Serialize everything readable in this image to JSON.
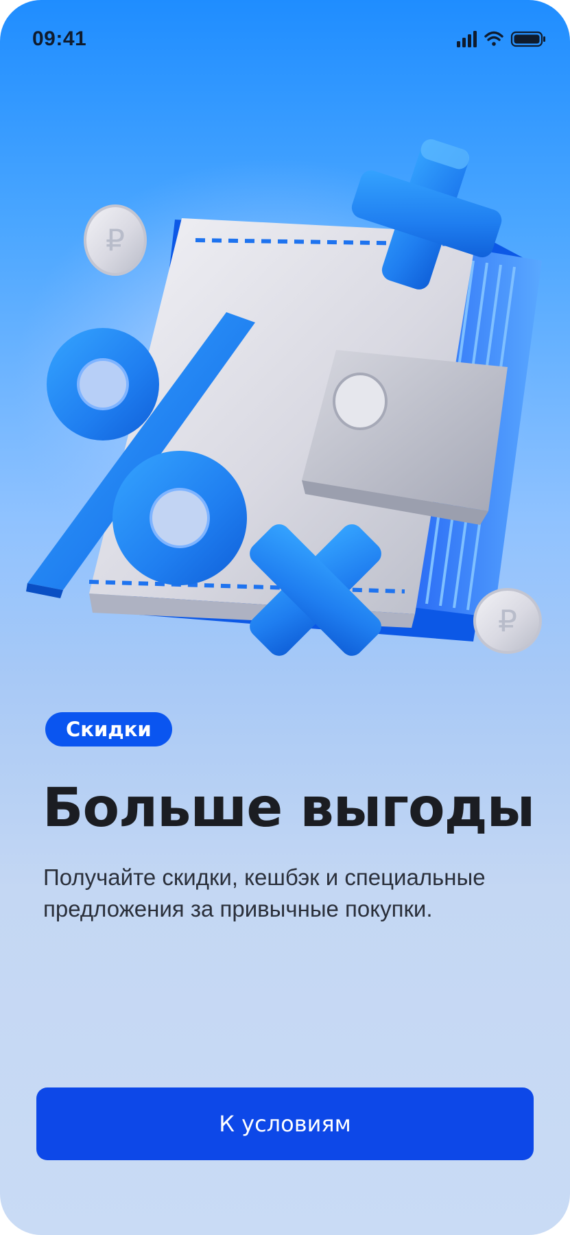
{
  "status_bar": {
    "time": "09:41",
    "icons": [
      "signal-icon",
      "wifi-icon",
      "battery-icon"
    ]
  },
  "hero": {
    "illustration": "wallet-with-percent-plus-times-coins-illustration"
  },
  "content": {
    "badge": "Скидки",
    "title": "Больше выгоды",
    "subtitle": "Получайте скидки, кешбэк и специальные предложения за привычные покупки."
  },
  "actions": {
    "primary_label": "К условиям"
  },
  "colors": {
    "accent": "#0d48e8",
    "badge": "#0a55f0",
    "title": "#1b1d22"
  }
}
